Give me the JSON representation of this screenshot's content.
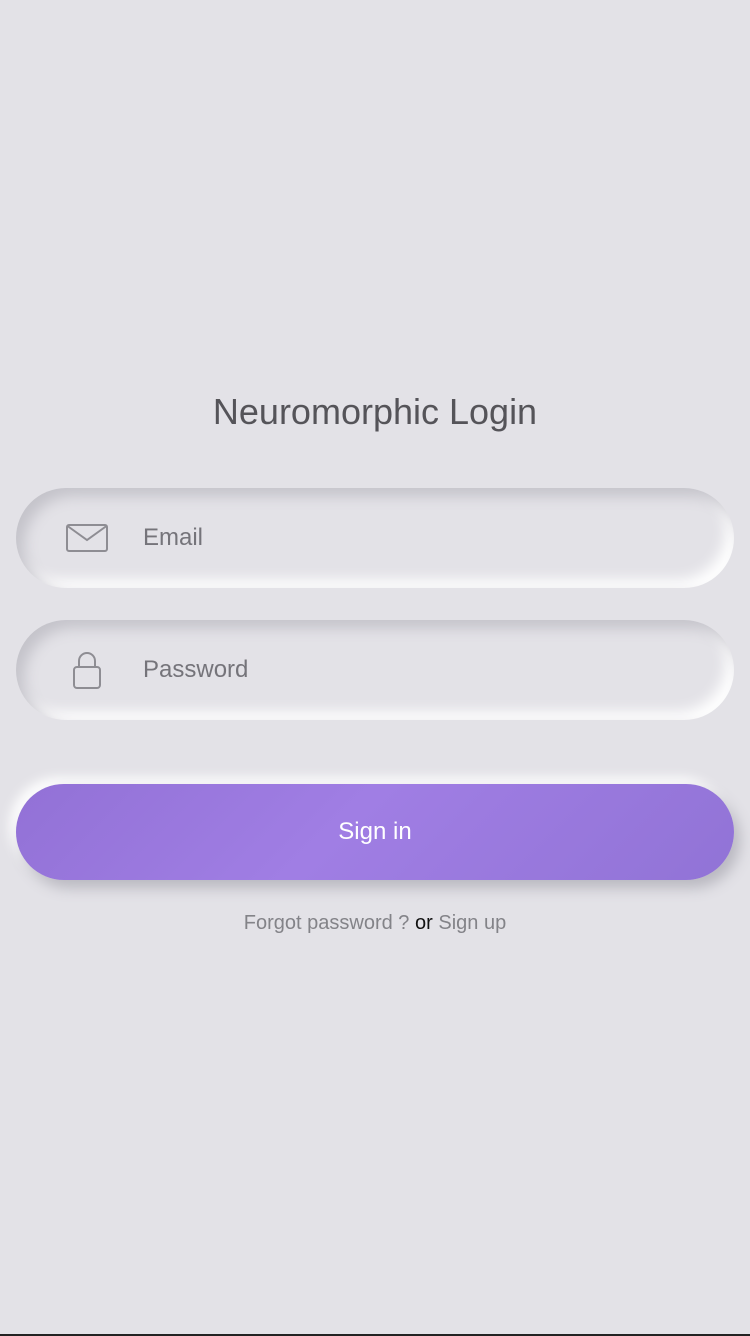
{
  "page": {
    "title": "Neuromorphic Login"
  },
  "form": {
    "email": {
      "placeholder": "Email",
      "value": "",
      "icon": "envelope-icon"
    },
    "password": {
      "placeholder": "Password",
      "value": "",
      "icon": "lock-icon"
    },
    "signin_label": "Sign in"
  },
  "footer": {
    "forgot_label": "Forgot password ?",
    "or_label": "or",
    "signup_label": "Sign up"
  },
  "colors": {
    "background": "#e3e2e7",
    "accent": "#9f7ae3",
    "title": "#555459",
    "muted": "#838388"
  }
}
